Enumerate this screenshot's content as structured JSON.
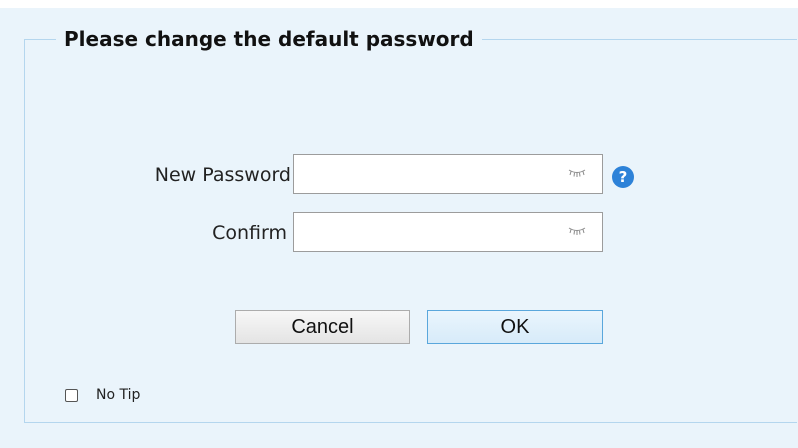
{
  "dialog": {
    "title": "Please change the default password"
  },
  "form": {
    "new_password": {
      "label": "New Password",
      "value": "",
      "placeholder": "",
      "toggle_icon": "eye-closed-icon",
      "help_icon": "question-mark-icon",
      "help_glyph": "?"
    },
    "confirm": {
      "label": "Confirm",
      "value": "",
      "placeholder": "",
      "toggle_icon": "eye-closed-icon"
    }
  },
  "buttons": {
    "cancel_label": "Cancel",
    "ok_label": "OK"
  },
  "no_tip": {
    "label": "No Tip",
    "checked": false
  },
  "colors": {
    "background": "#eaf4fb",
    "border": "#b4d6ee",
    "help_icon": "#2d82d8",
    "ok_border": "#5aa7dc"
  }
}
